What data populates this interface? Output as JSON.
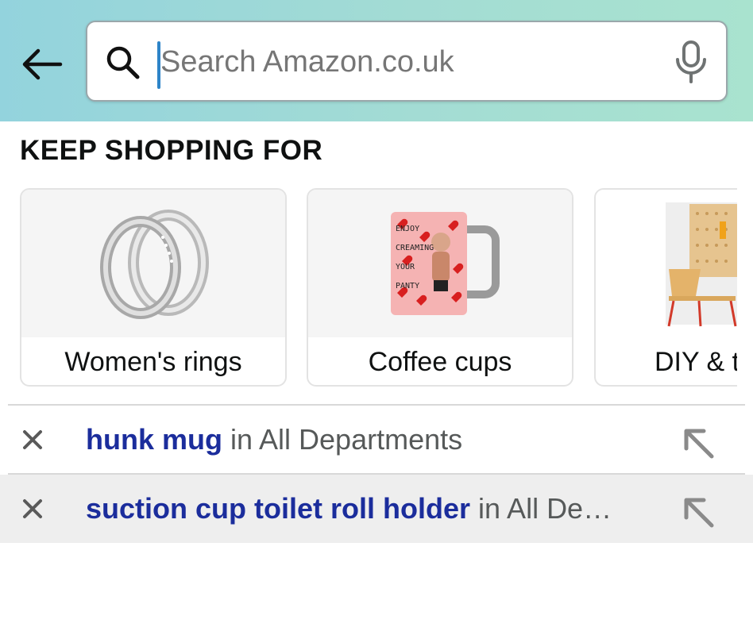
{
  "header": {
    "search": {
      "placeholder": "Search Amazon.co.uk",
      "value": ""
    }
  },
  "keep_shopping": {
    "title": "KEEP SHOPPING FOR",
    "cards": [
      {
        "label": "Women's rings"
      },
      {
        "label": "Coffee cups"
      },
      {
        "label": "DIY & t"
      }
    ]
  },
  "mug_print": {
    "lines": [
      "ENJOY",
      "CREAMING",
      "YOUR",
      "PANTY"
    ]
  },
  "suggestions": [
    {
      "term": "hunk mug",
      "scope": " in All Departments"
    },
    {
      "term": "suction cup toilet roll holder",
      "scope": " in All De…"
    }
  ],
  "colors": {
    "header_gradient_start": "#93d3dd",
    "header_gradient_end": "#a9e3cf",
    "suggestion_term": "#1b2d9c",
    "caret": "#2d84c8"
  }
}
